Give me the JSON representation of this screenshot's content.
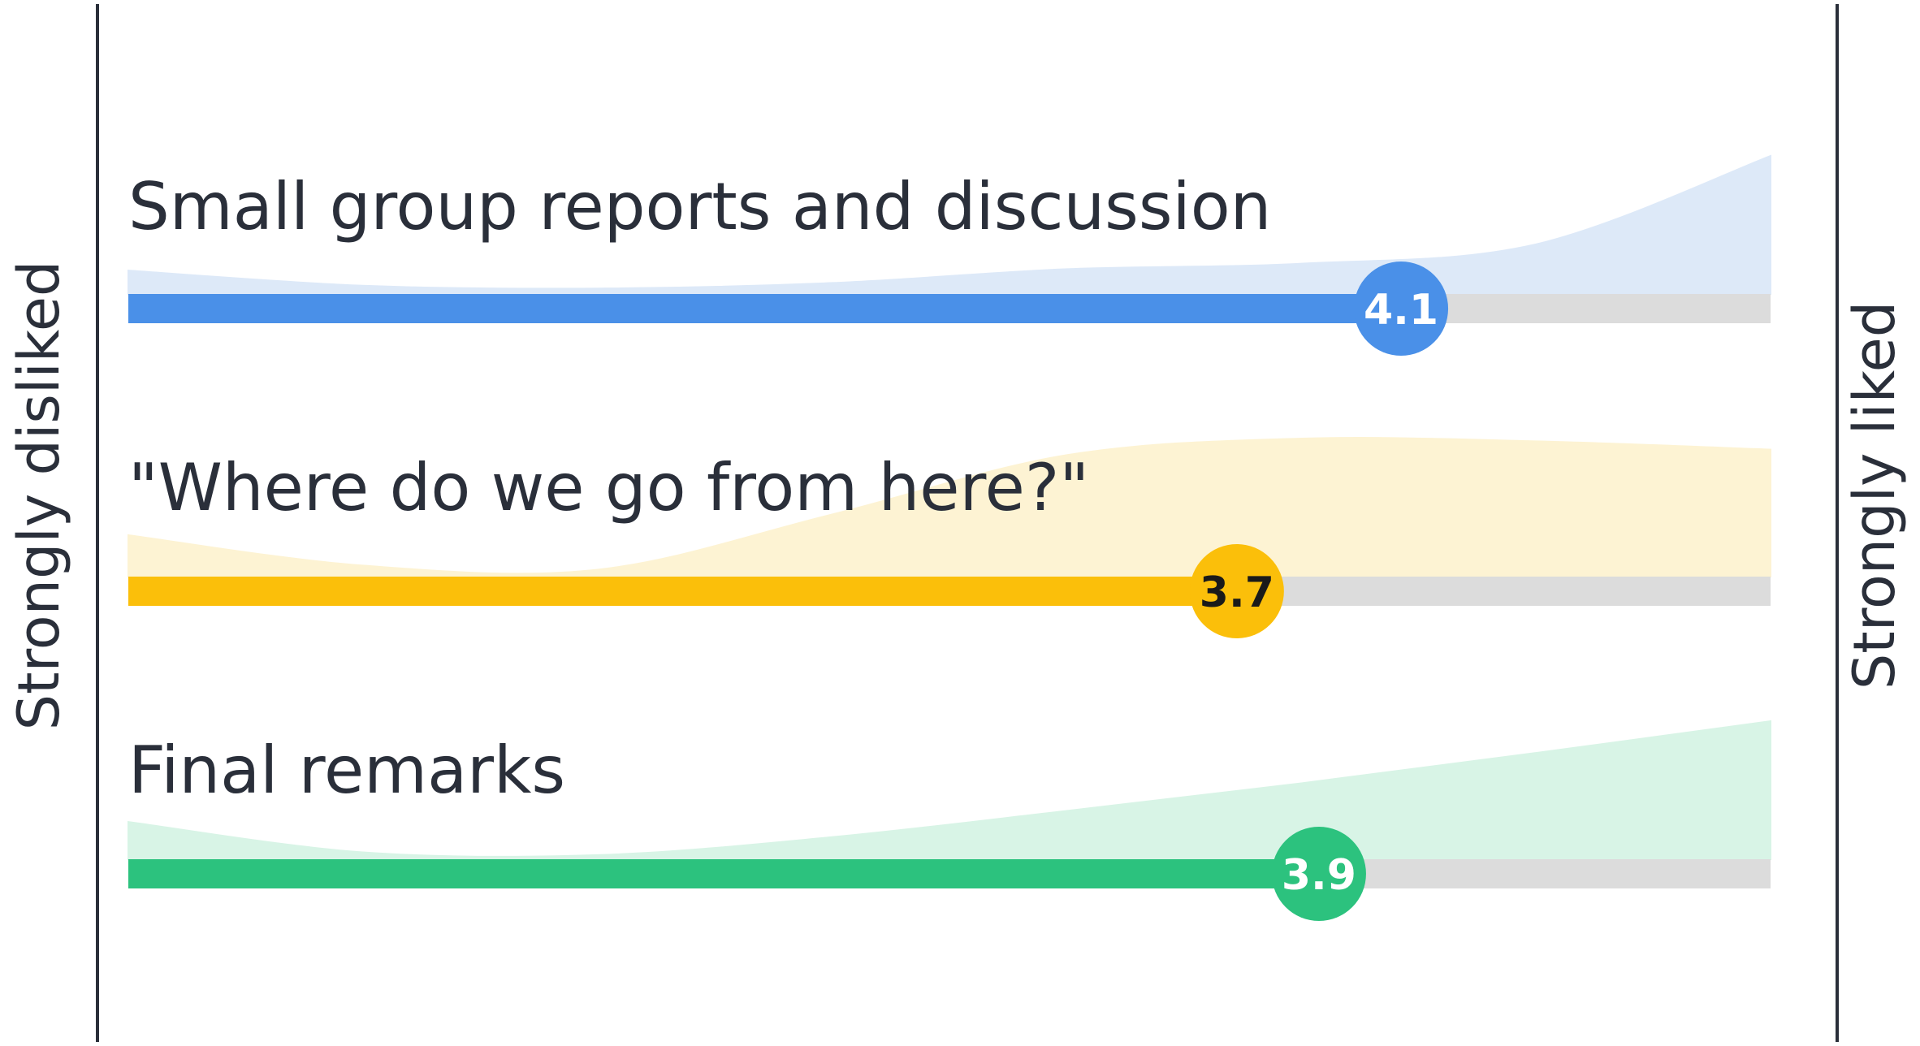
{
  "chart_data": {
    "type": "bar",
    "scale": {
      "min": 1,
      "max": 5,
      "left_label": "Strongly disliked",
      "right_label": "Strongly liked"
    },
    "items": [
      {
        "label": "Small group reports and discussion",
        "value": 4.1,
        "value_label": "4.1",
        "color": "#4a90e8",
        "fill": "#dde9f8",
        "text_color": "#ffffff",
        "distribution": [
          0.17,
          0.06,
          0.04,
          0.08,
          0.18,
          0.22,
          0.36,
          1.0
        ]
      },
      {
        "label": "\"Where do we go from here?\"",
        "value": 3.7,
        "value_label": "3.7",
        "color": "#fbbf0a",
        "fill": "#fdf3d3",
        "text_color": "#1a1a1a",
        "distribution": [
          0.3,
          0.08,
          0.05,
          0.45,
          0.88,
          1.0,
          0.98,
          0.92
        ]
      },
      {
        "label": "Final remarks",
        "value": 3.9,
        "value_label": "3.9",
        "color": "#2cc27e",
        "fill": "#d8f4e6",
        "text_color": "#ffffff",
        "distribution": [
          0.27,
          0.05,
          0.03,
          0.16,
          0.35,
          0.55,
          0.77,
          1.0
        ]
      }
    ]
  }
}
